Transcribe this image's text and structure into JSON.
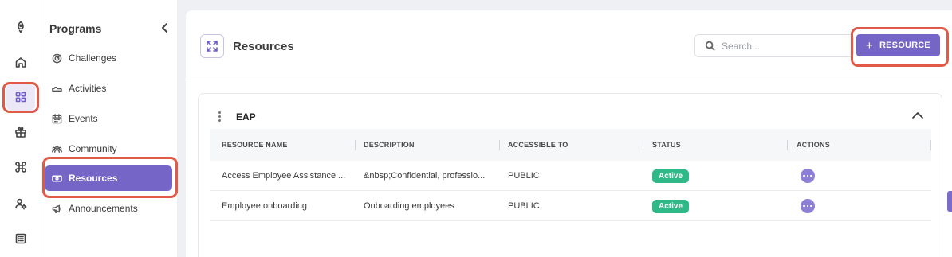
{
  "rail": {
    "icons": [
      "rocket-icon",
      "home-icon",
      "grid-icon",
      "gift-icon",
      "command-icon",
      "user-settings-icon",
      "list-icon"
    ],
    "active_index": 2
  },
  "sidebar": {
    "title": "Programs",
    "items": [
      {
        "label": "Challenges",
        "icon": "target-icon"
      },
      {
        "label": "Activities",
        "icon": "shoe-icon"
      },
      {
        "label": "Events",
        "icon": "calendar-icon"
      },
      {
        "label": "Community",
        "icon": "people-icon"
      },
      {
        "label": "Resources",
        "icon": "money-icon",
        "active": true
      },
      {
        "label": "Announcements",
        "icon": "megaphone-icon"
      }
    ]
  },
  "header": {
    "title": "Resources",
    "search_placeholder": "Search...",
    "add_button_label": "RESOURCE"
  },
  "section": {
    "title": "EAP",
    "columns": [
      "RESOURCE NAME",
      "DESCRIPTION",
      "ACCESSIBLE TO",
      "STATUS",
      "ACTIONS"
    ],
    "rows": [
      {
        "name": "Access Employee Assistance ...",
        "description": "&nbsp;Confidential, professio...",
        "accessible_to": "PUBLIC",
        "status": "Active"
      },
      {
        "name": "Employee onboarding",
        "description": "Onboarding employees",
        "accessible_to": "PUBLIC",
        "status": "Active"
      }
    ]
  },
  "colors": {
    "accent": "#7565c6",
    "status_active": "#2fb989",
    "highlight": "#e05a47"
  }
}
